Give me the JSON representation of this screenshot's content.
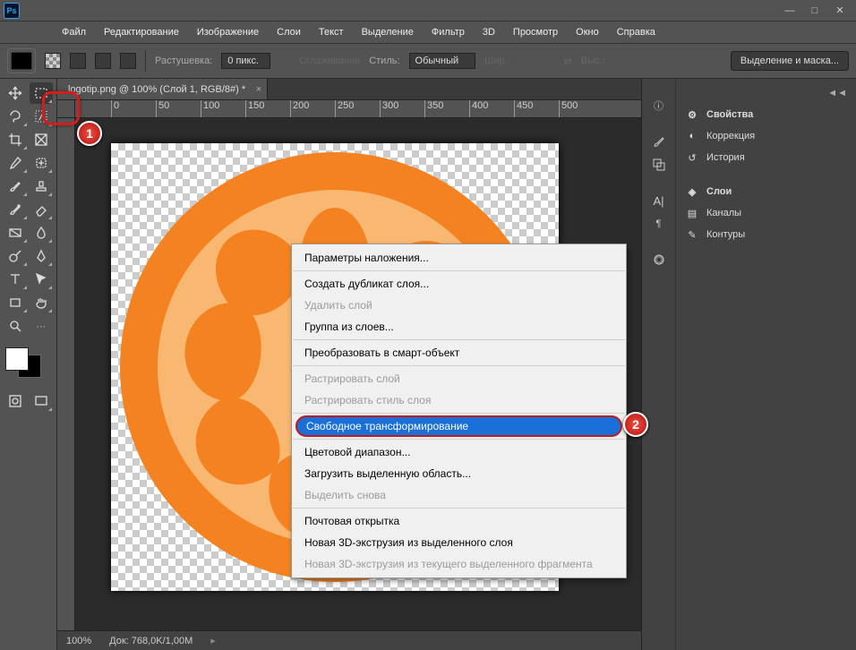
{
  "menubar": [
    "Файл",
    "Редактирование",
    "Изображение",
    "Слои",
    "Текст",
    "Выделение",
    "Фильтр",
    "3D",
    "Просмотр",
    "Окно",
    "Справка"
  ],
  "optbar": {
    "feather_label": "Растушевка:",
    "feather_value": "0 пикс.",
    "antialias_label": "Сглаживание",
    "style_label": "Стиль:",
    "style_value": "Обычный",
    "width_label": "Шир.:",
    "height_label": "Выс.:",
    "mask_btn": "Выделение и маска..."
  },
  "doc_tab": "logotip.png @ 100% (Слой 1, RGB/8#) *",
  "ruler_ticks": [
    "0",
    "50",
    "100",
    "150",
    "200",
    "250",
    "300",
    "350",
    "400",
    "450",
    "500"
  ],
  "status": {
    "zoom": "100%",
    "docsize": "Док: 768,0K/1,00M"
  },
  "panels": {
    "group1": [
      "Свойства",
      "Коррекция",
      "История"
    ],
    "group2": [
      "Слои",
      "Каналы",
      "Контуры"
    ]
  },
  "context_menu": [
    {
      "t": "Параметры наложения...",
      "en": true
    },
    {
      "sep": true
    },
    {
      "t": "Создать дубликат слоя...",
      "en": true
    },
    {
      "t": "Удалить слой",
      "en": false
    },
    {
      "t": "Группа из слоев...",
      "en": true
    },
    {
      "sep": true
    },
    {
      "t": "Преобразовать в смарт-объект",
      "en": true
    },
    {
      "sep": true
    },
    {
      "t": "Растрировать слой",
      "en": false
    },
    {
      "t": "Растрировать стиль слоя",
      "en": false
    },
    {
      "sep": true
    },
    {
      "t": "Свободное трансформирование",
      "en": true,
      "sel": true
    },
    {
      "sep": true
    },
    {
      "t": "Цветовой диапазон...",
      "en": true
    },
    {
      "t": "Загрузить выделенную область...",
      "en": true
    },
    {
      "t": "Выделить снова",
      "en": false
    },
    {
      "sep": true
    },
    {
      "t": "Почтовая открытка",
      "en": true
    },
    {
      "t": "Новая 3D-экструзия из выделенного слоя",
      "en": true
    },
    {
      "t": "Новая 3D-экструзия из текущего выделенного фрагмента",
      "en": false
    }
  ],
  "ann": {
    "b1": "1",
    "b2": "2"
  }
}
